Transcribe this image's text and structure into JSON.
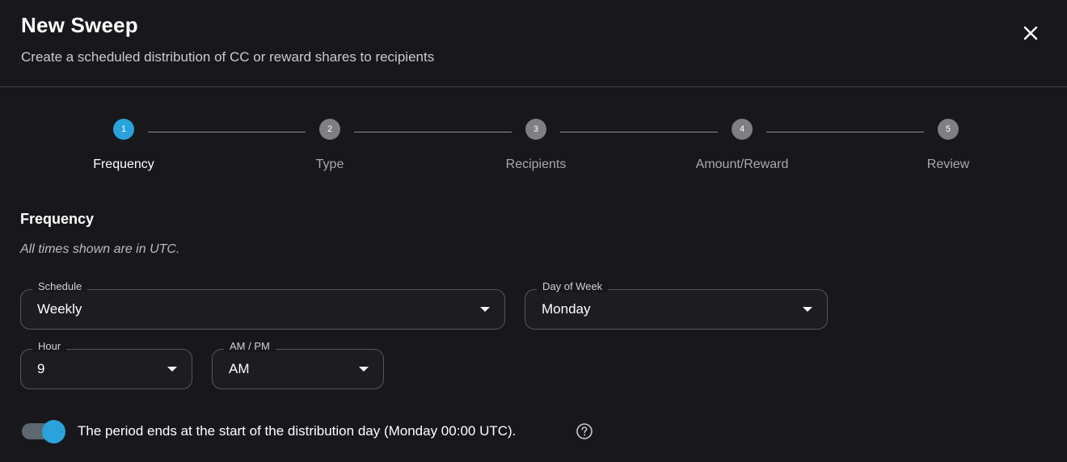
{
  "header": {
    "title": "New Sweep",
    "subtitle": "Create a scheduled distribution of CC or reward shares to recipients",
    "close_icon": "close-icon"
  },
  "stepper": {
    "active_step": 1,
    "steps": [
      {
        "number": "1",
        "label": "Frequency",
        "active": true
      },
      {
        "number": "2",
        "label": "Type",
        "active": false
      },
      {
        "number": "3",
        "label": "Recipients",
        "active": false
      },
      {
        "number": "4",
        "label": "Amount/Reward",
        "active": false
      },
      {
        "number": "5",
        "label": "Review",
        "active": false
      }
    ]
  },
  "frequency": {
    "title": "Frequency",
    "note": "All times shown are in UTC.",
    "schedule": {
      "label": "Schedule",
      "value": "Weekly"
    },
    "day_of_week": {
      "label": "Day of Week",
      "value": "Monday"
    },
    "hour": {
      "label": "Hour",
      "value": "9"
    },
    "ampm": {
      "label": "AM / PM",
      "value": "AM"
    },
    "period_toggle": {
      "on": true,
      "text": "The period ends at the start of the distribution day (Monday 00:00 UTC)."
    },
    "help_icon": "question-circle-icon"
  },
  "colors": {
    "background": "#18181c",
    "accent": "#2aa3dc",
    "inactive_step": "#7e7e84",
    "border": "#55555c"
  }
}
